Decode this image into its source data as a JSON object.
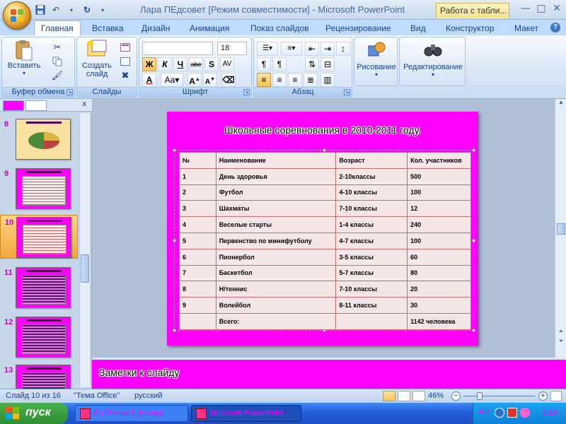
{
  "window": {
    "title": "Лара ПЕдсовет [Режим совместимости] - Microsoft PowerPoint",
    "context_tab": "Работа с табли...",
    "controls": [
      "—",
      "□",
      "✕"
    ]
  },
  "ribbon": {
    "tabs": [
      "Главная",
      "Вставка",
      "Дизайн",
      "Анимация",
      "Показ слайдов",
      "Рецензирование",
      "Вид",
      "Конструктор",
      "Макет"
    ],
    "active_tab": "Главная",
    "groups": {
      "clipboard": {
        "label": "Буфер обмена",
        "paste": "Вставить"
      },
      "slides": {
        "label": "Слайды",
        "create_slide": "Создать слайд"
      },
      "font": {
        "label": "Шрифт",
        "font_name": "",
        "font_size": "18",
        "bold": "Ж",
        "italic": "К",
        "underline": "Ч",
        "strike": "abe",
        "shadow": "S"
      },
      "paragraph": {
        "label": "Абзац"
      },
      "drawing": {
        "label": "Рисование"
      },
      "editing": {
        "label": "Редактирование"
      }
    }
  },
  "thumbnails": [
    {
      "num": "8"
    },
    {
      "num": "9"
    },
    {
      "num": "10",
      "selected": true
    },
    {
      "num": "11"
    },
    {
      "num": "12"
    },
    {
      "num": "13"
    }
  ],
  "slide": {
    "title": "Школьные соревнования в 2010-2011 году.",
    "table": {
      "header": [
        "№",
        "Наименование",
        "Возраст",
        "Кол. участников"
      ],
      "rows": [
        [
          "1",
          "День здоровья",
          "2-10классы",
          "500"
        ],
        [
          "2",
          "Футбол",
          "4-10 классы",
          "100"
        ],
        [
          "3",
          "Шахматы",
          "7-10 классы",
          "12"
        ],
        [
          "4",
          "Веселые старты",
          "1-4 классы",
          "240"
        ],
        [
          "5",
          "Первенство по минифутболу",
          "4-7 классы",
          "100"
        ],
        [
          "6",
          "Пионербол",
          "3-5 классы",
          "60"
        ],
        [
          "7",
          "Баскетбол",
          "5-7 классы",
          "80"
        ],
        [
          "8",
          "Н/теннис",
          "7-10 классы",
          "20"
        ],
        [
          "9",
          "Волейбол",
          "8-11 классы",
          "30"
        ],
        [
          "",
          "Всего:",
          "",
          "1142 человека"
        ]
      ]
    }
  },
  "notes": {
    "placeholder": "Заметки к слайду"
  },
  "statusbar": {
    "slide_info": "Слайд 10 из 16",
    "theme": "\"Тема Office\"",
    "language": "русский",
    "zoom": "46%",
    "zoom_fraction": 0.46
  },
  "taskbar": {
    "start": "пуск",
    "tasks": [
      "Публичный доклад ...",
      "Microsoft PowerPoint ..."
    ],
    "clock": "9:19"
  }
}
